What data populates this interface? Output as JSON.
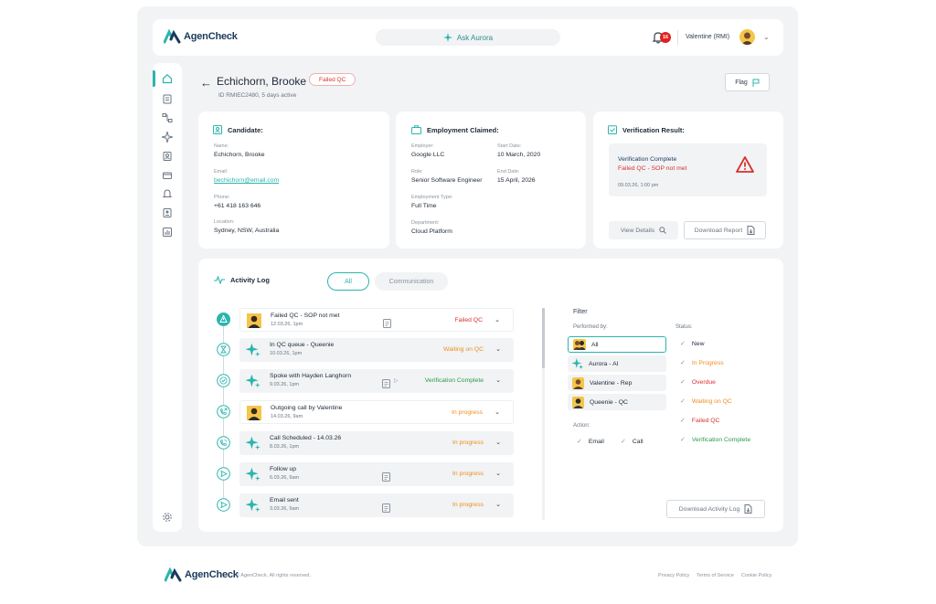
{
  "app": {
    "brand": "AgenCheck"
  },
  "header": {
    "ask_label": "Ask Aurora",
    "notification_count": "16",
    "user_name": "Valentine (RMI)"
  },
  "sidebar": {
    "items": [
      "home",
      "clipboard",
      "workflow",
      "sparkle",
      "contacts",
      "card",
      "bell",
      "id-card",
      "reports"
    ],
    "bottom": "settings"
  },
  "candidate": {
    "name": "Echichorn, Brooke",
    "status": "Failed QC",
    "meta": "ID RMIEC2480, 5 days active",
    "flag_label": "Flag"
  },
  "candidate_card": {
    "title": "Candidate:",
    "fields": [
      {
        "label": "Name:",
        "value": "Echichorn, Brooke"
      },
      {
        "label": "Email:",
        "value": "bechichorn@email.com"
      },
      {
        "label": "Phone:",
        "value": "+61 418 163 646"
      },
      {
        "label": "Location:",
        "value": "Sydney, NSW, Australia"
      }
    ]
  },
  "employment_card": {
    "title": "Employment Claimed:",
    "employer_label": "Employer:",
    "employer": "Google LLC",
    "start_label": "Start Date:",
    "start": "10 March, 2020",
    "role_label": "Role:",
    "role": "Senior Software Engineer",
    "end_label": "End Date:",
    "end": "15 April, 2026",
    "type_label": "Employment Type:",
    "type": "Full Time",
    "dept_label": "Department:",
    "dept": "Cloud Platform"
  },
  "verification_card": {
    "title": "Verification Result:",
    "status_line": "Verification Complete",
    "result_line": "Failed QC - SOP not met",
    "timestamp": "09.03.26, 1:00 pm",
    "view_details": "View Details",
    "download_report": "Download Report"
  },
  "activity": {
    "title": "Activity Log",
    "tabs": [
      "All",
      "Communication"
    ],
    "events": [
      {
        "title": "Failed QC - SOP not met",
        "date": "12.03.26, 1pm",
        "status": "Failed QC",
        "tone": "red",
        "icon": "alert-icon",
        "avatar": "person",
        "doc": true,
        "play": false
      },
      {
        "title": "In QC queue - Queenie",
        "date": "10.03.26, 1pm",
        "status": "Waiting on QC",
        "tone": "orange",
        "icon": "hourglass-icon",
        "avatar": "sparkle",
        "doc": false,
        "play": false
      },
      {
        "title": "Spoke with Hayden Langhorn",
        "date": "9.03.26, 1pm",
        "status": "Verification Complete",
        "tone": "green",
        "icon": "check-circle-icon",
        "avatar": "sparkle",
        "doc": true,
        "play": true
      },
      {
        "title": "Outgoing call by Valentine",
        "date": "14.03.26, 9am",
        "status": "In progress",
        "tone": "orange",
        "icon": "phone-out-icon",
        "avatar": "person",
        "doc": false,
        "play": false
      },
      {
        "title": "Call Scheduled - 14.03.26",
        "date": "8.03.26, 1pm",
        "status": "In progress",
        "tone": "orange",
        "icon": "phone-icon",
        "avatar": "sparkle",
        "doc": false,
        "play": false
      },
      {
        "title": "Follow up",
        "date": "6.03.26, 9am",
        "status": "In progress",
        "tone": "orange",
        "icon": "send-icon",
        "avatar": "sparkle",
        "doc": true,
        "play": false
      },
      {
        "title": "Email sent",
        "date": "3.03.26, 9am",
        "status": "In progress",
        "tone": "orange",
        "icon": "send-icon",
        "avatar": "sparkle",
        "doc": true,
        "play": false
      }
    ]
  },
  "filter": {
    "title": "Filter",
    "performed_by_label": "Performed by:",
    "performed_by": [
      "All",
      "Aurora - AI",
      "Valentine - Rep",
      "Queenie - QC"
    ],
    "status_label": "Status:",
    "statuses": [
      {
        "label": "New",
        "tone": "dark"
      },
      {
        "label": "In Progress",
        "tone": "orange"
      },
      {
        "label": "Overdue",
        "tone": "red"
      },
      {
        "label": "Waiting on QC",
        "tone": "orange"
      },
      {
        "label": "Failed QC",
        "tone": "red"
      },
      {
        "label": "Verification Complete",
        "tone": "green"
      }
    ],
    "action_label": "Action:",
    "actions": [
      "Email",
      "Call"
    ],
    "download_log": "Download Activity Log"
  },
  "footer": {
    "copyright": "© AgenCheck. All rights reserved.",
    "links": [
      "Privacy Policy",
      "Terms of Service",
      "Cookie Policy"
    ]
  }
}
